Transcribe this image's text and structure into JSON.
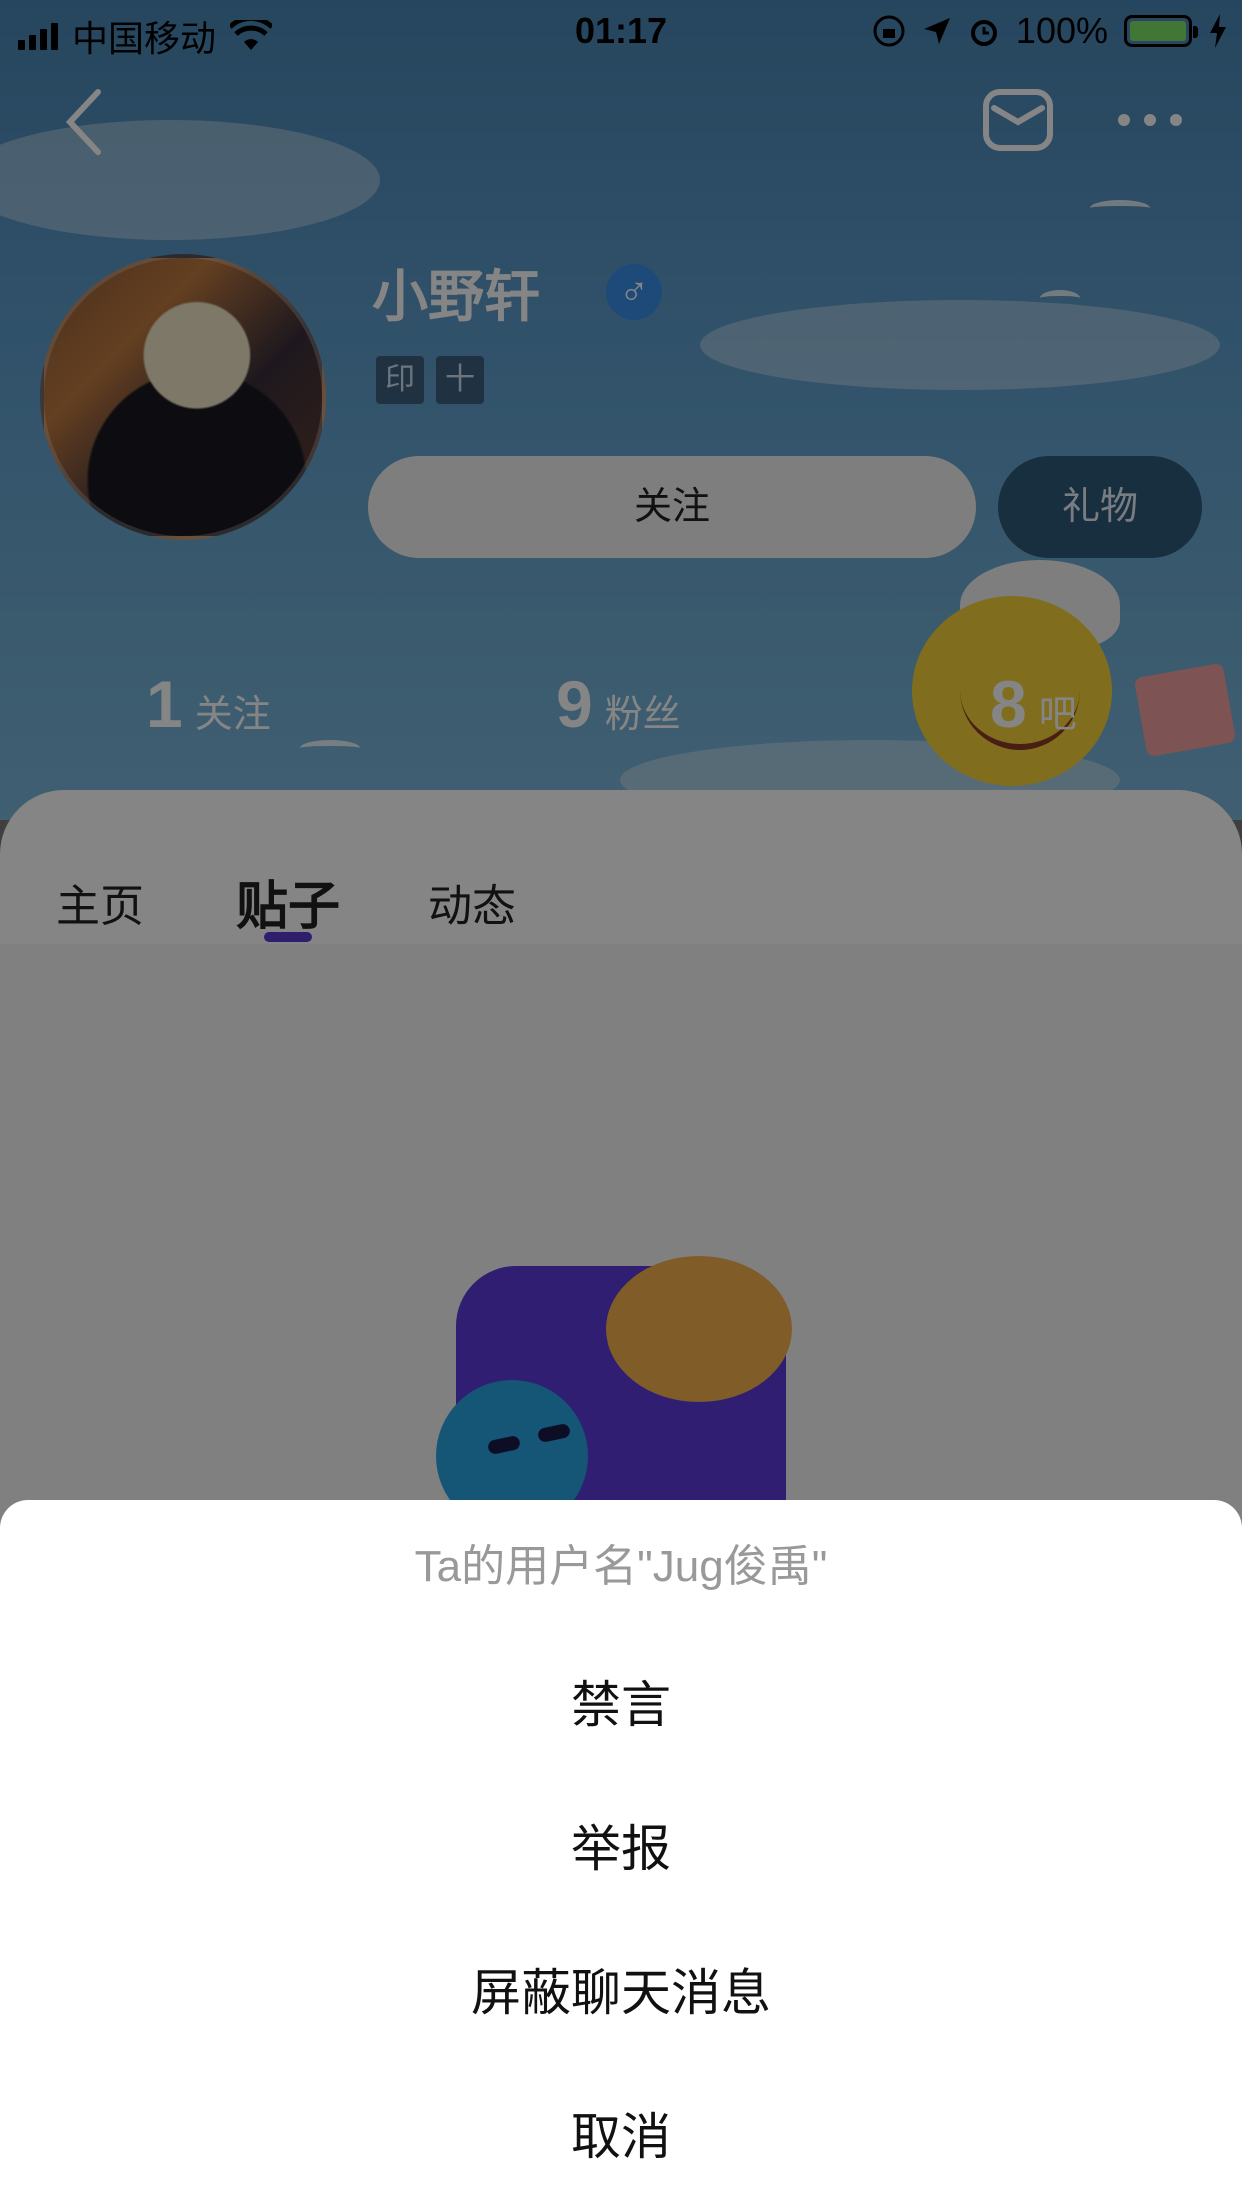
{
  "status_bar": {
    "carrier": "中国移动",
    "time": "01:17",
    "battery": "100%"
  },
  "profile": {
    "username": "小野轩",
    "gender_symbol": "♂",
    "badges": [
      "印",
      "十"
    ],
    "follow_label": "关注",
    "gift_label": "礼物",
    "stats": [
      {
        "value": "1",
        "label": "关注"
      },
      {
        "value": "9",
        "label": "粉丝"
      },
      {
        "value": "8",
        "label": "吧"
      }
    ]
  },
  "tabs": [
    {
      "label": "主页",
      "active": false
    },
    {
      "label": "贴子",
      "active": true
    },
    {
      "label": "动态",
      "active": false
    }
  ],
  "action_sheet": {
    "title": "Ta的用户名\"Jug俊禹\"",
    "items": [
      {
        "label": "禁言"
      },
      {
        "label": "举报"
      },
      {
        "label": "屏蔽聊天消息"
      },
      {
        "label": "取消"
      }
    ]
  },
  "colors": {
    "accent": "#5a3ad0",
    "gender": "#3a8ee8",
    "battery": "#7de36a"
  }
}
